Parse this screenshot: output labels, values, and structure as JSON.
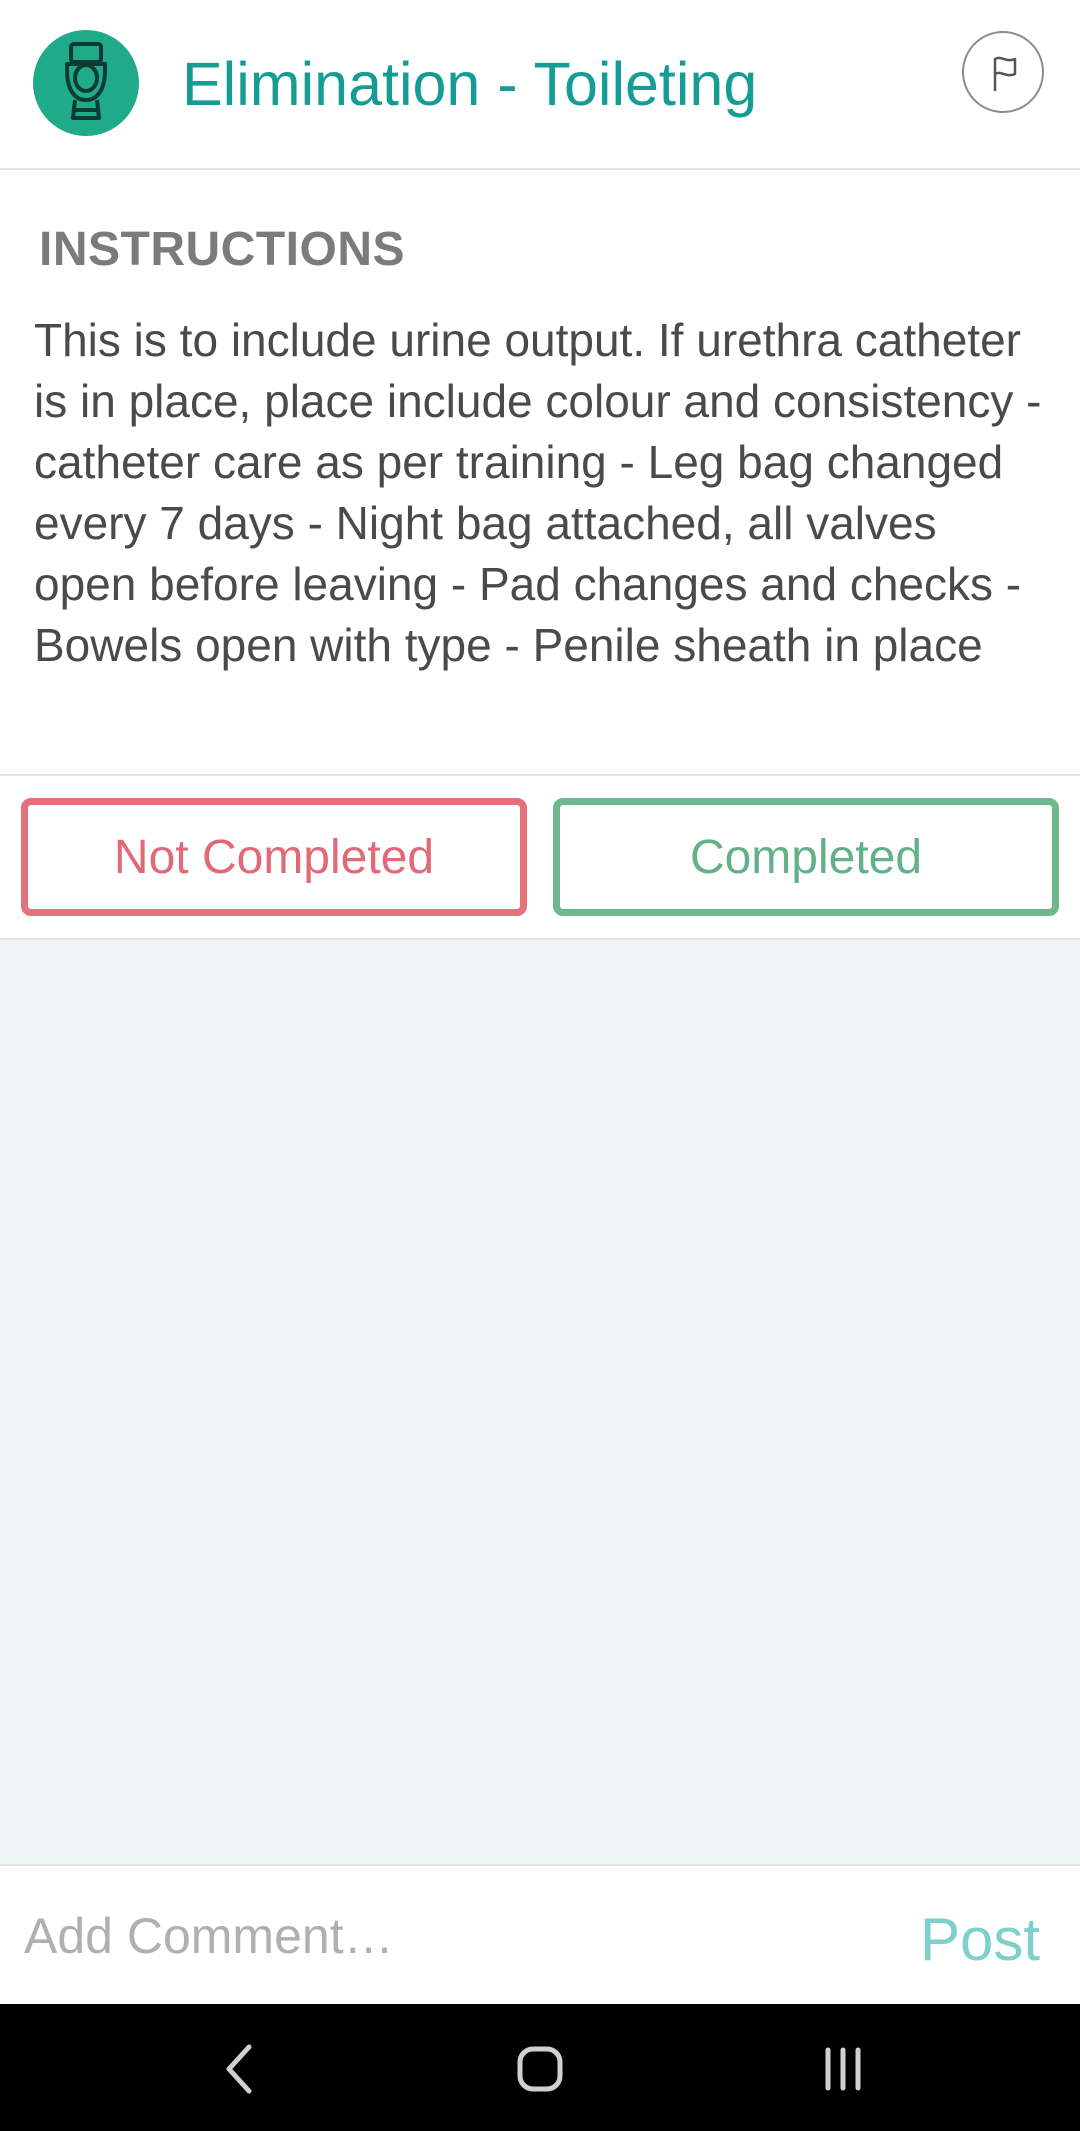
{
  "header": {
    "title": "Elimination - Toileting",
    "icon": "toilet-icon",
    "icon_color": "#1faa8a",
    "title_color": "#159c94",
    "flag_icon": "flag-icon"
  },
  "instructions": {
    "heading": "INSTRUCTIONS",
    "body": "This is to include urine output. If urethra catheter is in place, place include colour and consistency - catheter care as per training - Leg bag changed every 7 days - Night bag attached, all valves open before leaving - Pad changes and checks - Bowels open with type - Penile sheath in place"
  },
  "actions": {
    "not_completed_label": "Not Completed",
    "completed_label": "Completed",
    "not_completed_color": "#e4717c",
    "completed_color": "#6db88e"
  },
  "comment": {
    "placeholder": "Add Comment…",
    "post_label": "Post",
    "post_color": "#7fd0cc"
  },
  "navbar": {
    "back_icon": "back-icon",
    "home_icon": "home-icon",
    "recents_icon": "recents-icon"
  }
}
